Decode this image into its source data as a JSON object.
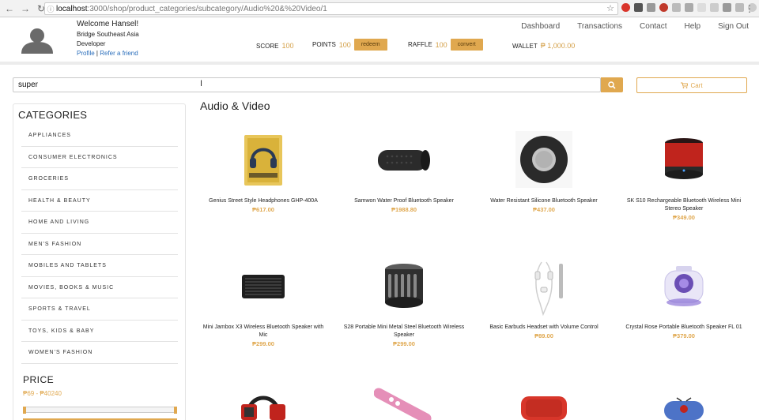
{
  "browser": {
    "url_host": "localhost",
    "url_path": ":3000/shop/product_categories/subcategory/Audio%20&%20Video/1"
  },
  "user": {
    "welcome": "Welcome Hansel!",
    "company": "Bridge Southeast Asia",
    "role": "Developer",
    "profile_link": "Profile",
    "separator": "|",
    "refer_link": "Refer a friend"
  },
  "stats": {
    "score_label": "SCORE",
    "score_value": "100",
    "points_label": "POINTS",
    "points_value": "100",
    "redeem_label": "redeem",
    "raffle_label": "RAFFLE",
    "raffle_value": "100",
    "convert_label": "convert",
    "wallet_label": "WALLET",
    "wallet_value": "₱ 1,000.00"
  },
  "nav": {
    "items": [
      "Dashboard",
      "Transactions",
      "Contact",
      "Help",
      "Sign Out"
    ]
  },
  "search": {
    "value": "super",
    "cart_label": "Cart"
  },
  "sidebar": {
    "categories_title": "CATEGORIES",
    "categories": [
      "APPLIANCES",
      "CONSUMER ELECTRONICS",
      "GROCERIES",
      "HEALTH & BEAUTY",
      "HOME AND LIVING",
      "MEN'S FASHION",
      "MOBILES AND TABLETS",
      "MOVIES, BOOKS & MUSIC",
      "SPORTS & TRAVEL",
      "TOYS, KIDS & BABY",
      "WOMEN'S FASHION"
    ],
    "price_title": "PRICE",
    "price_range": "₱69 - ₱40240"
  },
  "main": {
    "title": "Audio & Video",
    "products": [
      {
        "name": "Genius Street Style Headphones GHP-400A",
        "price": "₱617.00",
        "icon": "headphones-box-icon"
      },
      {
        "name": "Samwon Water Proof Bluetooth Speaker",
        "price": "₱1988.80",
        "icon": "cylinder-speaker-icon"
      },
      {
        "name": "Water Resistant Silicone Bluetooth Speaker",
        "price": "₱437.00",
        "icon": "round-speaker-icon"
      },
      {
        "name": "SK S10 Rechargeable Bluetooth Wireless Mini Stereo Speaker",
        "price": "₱349.00",
        "icon": "red-speaker-icon"
      },
      {
        "name": "Mini Jambox X3 Wireless Bluetooth Speaker with Mic",
        "price": "₱299.00",
        "icon": "box-speaker-icon"
      },
      {
        "name": "S28 Portable Mini Metal Steel Bluetooth Wireless Speaker",
        "price": "₱299.00",
        "icon": "metal-speaker-icon"
      },
      {
        "name": "Basic Earbuds Headset with Volume Control",
        "price": "₱89.00",
        "icon": "earbuds-icon"
      },
      {
        "name": "Crystal Rose Portable Bluetooth Speaker FL 01",
        "price": "₱379.00",
        "icon": "crystal-speaker-icon"
      }
    ]
  },
  "colors": {
    "accent": "#e0a84f",
    "link": "#2a6ebb"
  }
}
